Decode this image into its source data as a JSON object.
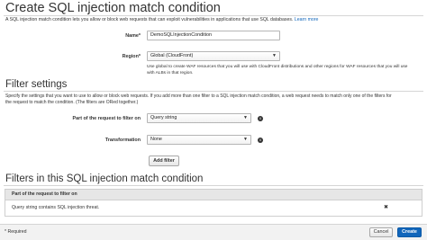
{
  "page": {
    "title": "Create SQL injection match condition",
    "intro": "A SQL injection match condition lets you allow or block web requests that can exploit vulnerabilities in applications that use SQL databases.",
    "learn_more": "Learn more"
  },
  "form": {
    "name_label": "Name*",
    "name_value": "DemoSQLInjectionCondition",
    "region_label": "Region*",
    "region_value": "Global (CloudFront)",
    "region_help_1": "Use global to create WAF resources that you will use with CloudFront distributions and other regions for WAF resources that you will use",
    "region_help_2": "with ALBs in that region."
  },
  "filter_settings": {
    "heading": "Filter settings",
    "desc_1": "Specify the settings that you want to use to allow or block web requests. If you add more than one filter to a SQL injection match condition, a web request needs to match only one of the filters for",
    "desc_2": "the request to match the condition. (The filters are ORed together.)",
    "part_label": "Part of the request to filter on",
    "part_value": "Query string",
    "transformation_label": "Transformation",
    "transformation_value": "None",
    "add_filter_label": "Add filter"
  },
  "filters_table": {
    "heading": "Filters in this SQL injection match condition",
    "column_header": "Part of the request to filter on",
    "rows": [
      {
        "text": "Query string contains SQL injection threat.",
        "remove": "✖"
      }
    ]
  },
  "footer": {
    "required_note": "* Required",
    "cancel_label": "Cancel",
    "create_label": "Create"
  },
  "colors": {
    "primary_button": "#1166bb",
    "link": "#1166bb"
  }
}
